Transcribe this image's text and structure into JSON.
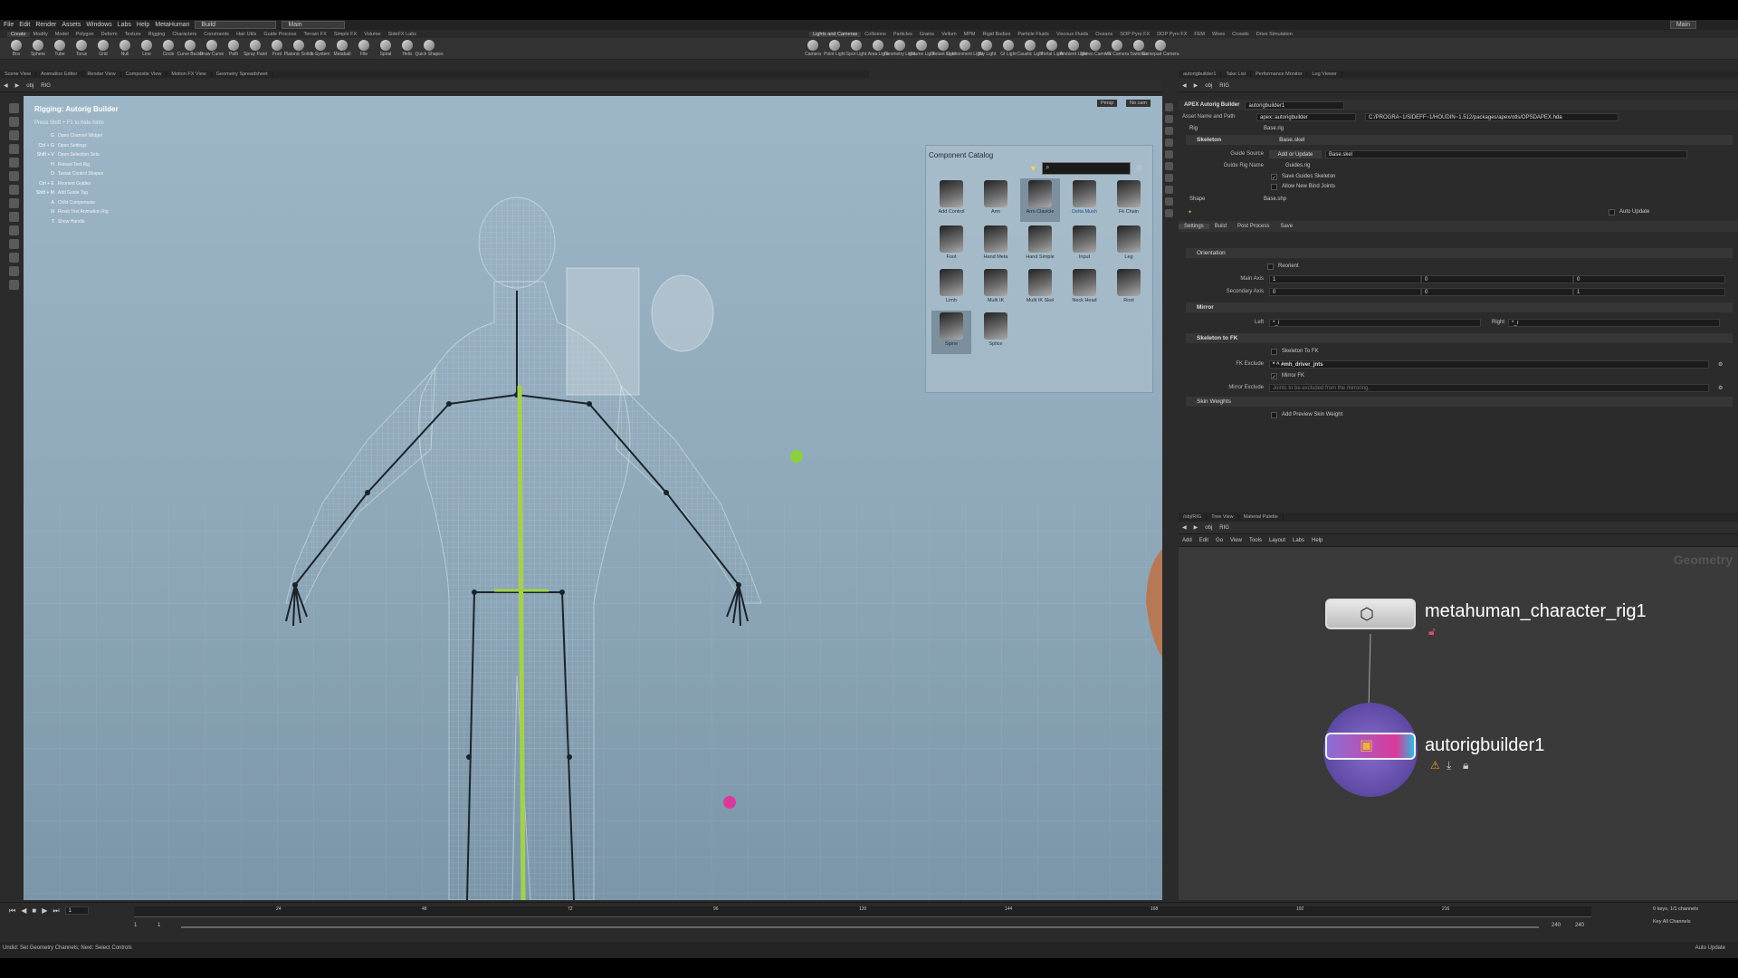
{
  "menubar": {
    "items": [
      "File",
      "Edit",
      "Render",
      "Assets",
      "Windows",
      "Labs",
      "Help",
      "MetaHuman"
    ],
    "desktop": "Build",
    "network": "Main",
    "right": "Main"
  },
  "shelf_tabs": [
    "Create",
    "Modify",
    "Model",
    "Polygon",
    "Deform",
    "Texture",
    "Rigging",
    "Characters",
    "Constraints",
    "Hair Utils",
    "Guide Process",
    "Terrain FX",
    "Simple FX",
    "Volume",
    "SideFX Labs"
  ],
  "shelf_tools": [
    "Box",
    "Sphere",
    "Tube",
    "Torus",
    "Grid",
    "Null",
    "Line",
    "Circle",
    "Curve Bezier",
    "Draw Curve",
    "Path",
    "Spray Paint",
    "Font",
    "Platonic Solids",
    "L-System",
    "Metaball",
    "File",
    "Spiral",
    "Helix",
    "Quick Shapes"
  ],
  "lights_tabs": [
    "Lights and Cameras",
    "Collisions",
    "Particles",
    "Grains",
    "Vellum",
    "MPM",
    "Rigid Bodies",
    "Particle Fluids",
    "Viscous Fluids",
    "Oceans",
    "SOP Pyro FX",
    "DOP Pyro FX",
    "FEM",
    "Wires",
    "Crowds",
    "Drive Simulation"
  ],
  "lights_tools": [
    "Camera",
    "Point Light",
    "Spot Light",
    "Area Light",
    "Geometry Light",
    "Volume Light",
    "Distant Light",
    "Environment Light",
    "Sky Light",
    "GI Light",
    "Caustic Light",
    "Portal Light",
    "Ambient Light",
    "Stereo Camera",
    "VR Camera",
    "Switcher",
    "Gamepad Camera"
  ],
  "left_tabs": [
    "Scene View",
    "Animation Editor",
    "Render View",
    "Composite View",
    "Motion FX View",
    "Geometry Spreadsheet"
  ],
  "right_tabs": [
    "autorigbuilder1",
    "Take List",
    "Performance Monitor",
    "Log Viewer"
  ],
  "path": {
    "obj": "obj",
    "rig": "RIG"
  },
  "viewport": {
    "persp": "Persp",
    "cam": "No cam",
    "hud_title": "Rigging: Autorig Builder",
    "hud_hint": "Press Shift + F1 to hide hints",
    "hotkeys": [
      {
        "key": "G",
        "desc": "Open Channel Widget"
      },
      {
        "key": "Ctrl + G",
        "desc": "Open Settings"
      },
      {
        "key": "Shift + V",
        "desc": "Open Selection Sets"
      },
      {
        "key": "H",
        "desc": "Reload Test Rig"
      },
      {
        "key": "O",
        "desc": "Tweak Control Shapes"
      },
      {
        "key": "Ctrl + E",
        "desc": "Reorient Guides"
      },
      {
        "key": "Shift + M",
        "desc": "Add Guide Tag"
      },
      {
        "key": "A",
        "desc": "Child Compensate"
      },
      {
        "key": "N",
        "desc": "Reset Test Animation Rig"
      },
      {
        "key": "T",
        "desc": "Show Handle"
      }
    ]
  },
  "catalog": {
    "title": "Component Catalog",
    "items": [
      "Add Control",
      "Arm",
      "Arm Clavicle",
      "Delta Mush",
      "Fk Chain",
      "Foot",
      "Hand Meta",
      "Hand Simple",
      "Input",
      "Leg",
      "Limb",
      "Multi IK",
      "Multi IK Skel",
      "Neck Head",
      "Root",
      "Spine",
      "Splice"
    ]
  },
  "params": {
    "node_type": "APEX Autorig Builder",
    "node_name": "autorigbuilder1",
    "asset_label": "Asset Name and Path",
    "asset_name": "apex::autorigbuilder",
    "asset_path": "C:/PROGRA~1/SIDEFF~1/HOUDIN~1.512/packages/apex/otls/OPSDAPEX.hda",
    "rig_label": "Rig",
    "rig_value": "Base.rig",
    "skeleton_label": "Skeleton",
    "skeleton_value": "Base.skel",
    "guide_source_label": "Guide Source",
    "guide_source_btn": "Add or Update",
    "guide_source_value": "Base.skel",
    "guide_rig_label": "Guide Rig Name",
    "guide_rig_value": "Guides.rig",
    "save_guides": "Save Guides Skeleton",
    "allow_new": "Allow New Bind Joints",
    "shape_label": "Shape",
    "shape_value": "Base.shp",
    "auto_update": "Auto Update",
    "tabs": [
      "Settings",
      "Build",
      "Post Process",
      "Save"
    ],
    "orientation": "Orientation",
    "reorient": "Reorient",
    "main_axis_label": "Main Axis",
    "main_axis": [
      "1",
      "0",
      "0"
    ],
    "secondary_axis_label": "Secondary Axis",
    "secondary_axis": [
      "0",
      "0",
      "1"
    ],
    "mirror": "Mirror",
    "left_label": "Left",
    "left_value": "*_l",
    "right_label": "Right",
    "right_value": "*_r",
    "skeleton_to_fk": "Skeleton to FK",
    "skeleton_to_fk_chk": "Skeleton To FK",
    "fk_exclude_label": "FK Exclude",
    "fk_exclude_value": "* ^ #mh_driver_jnts",
    "mirror_fk": "Mirror FK",
    "mirror_exclude_label": "Mirror Exclude",
    "mirror_exclude_placeholder": "Joints to be excluded from the mirroring.",
    "skin_weights": "Skin Weights",
    "add_preview": "Add Preview Skin Weight"
  },
  "network": {
    "tabs": [
      "/obj/RIG",
      "Tree View",
      "Material Palette"
    ],
    "menu": [
      "Add",
      "Edit",
      "Go",
      "View",
      "Tools",
      "Layout",
      "Labs",
      "Help"
    ],
    "context": "Geometry",
    "node1": "metahuman_character_rig1",
    "node2": "autorigbuilder1"
  },
  "timeline": {
    "frame": "1",
    "start": "1",
    "start2": "1",
    "end": "240",
    "end2": "240",
    "ticks": [
      "24",
      "48",
      "72",
      "96",
      "120",
      "144",
      "168",
      "192",
      "216"
    ],
    "keys": "0 keys, 1/1 channels",
    "key_all": "Key All Channels",
    "auto_update": "Auto Update"
  },
  "status": "Undid: Set Geometry Channels; Next: Select Controls",
  "colors": {
    "accent": "#8cd040",
    "spine": "#a5d14a",
    "node_pink": "#d93a9a",
    "node_purple": "#8b6fd6"
  }
}
